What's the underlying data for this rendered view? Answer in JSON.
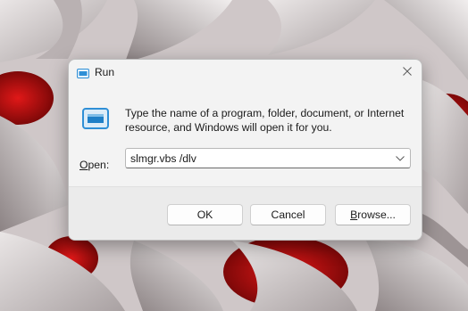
{
  "dialog": {
    "title": "Run",
    "title_icon": "run-app-icon",
    "close_icon": "close-icon",
    "description": "Type the name of a program, folder, document, or Internet resource, and Windows will open it for you.",
    "open_label_prefix": "O",
    "open_label_rest": "pen:",
    "open_value": "slmgr.vbs /dlv",
    "dropdown_icon": "chevron-down-icon",
    "buttons": {
      "ok": "OK",
      "cancel": "Cancel",
      "browse_prefix": "B",
      "browse_rest": "rowse..."
    }
  },
  "colors": {
    "accent_blue": "#2f8fd6",
    "wallpaper_red": "#c01010",
    "dialog_bg": "#f3f3f3",
    "footer_bg": "#ebebeb"
  }
}
